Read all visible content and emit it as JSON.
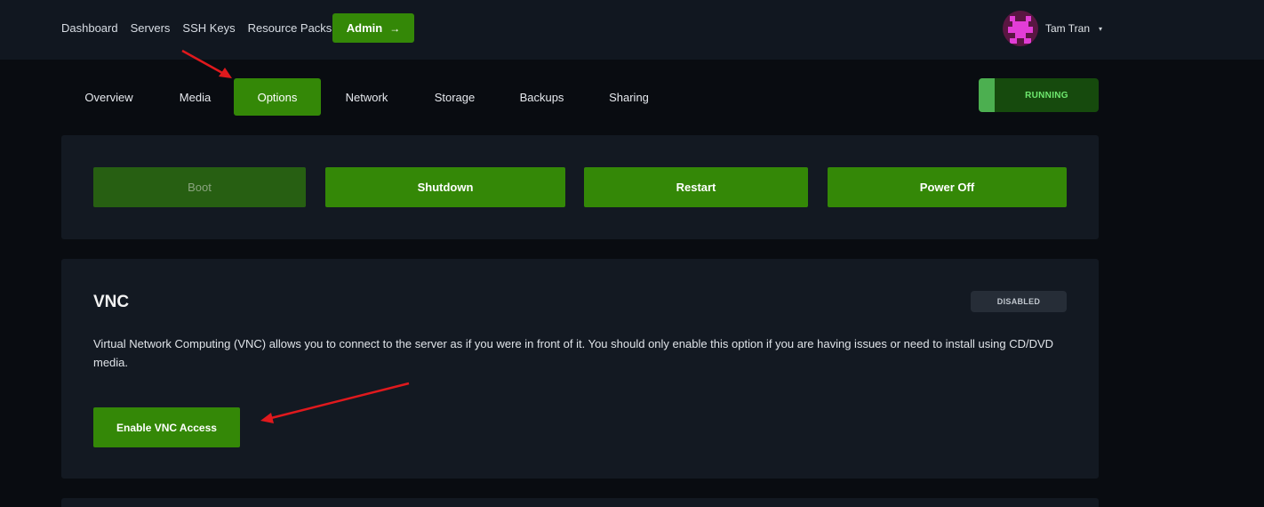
{
  "topnav": {
    "links": [
      "Dashboard",
      "Servers",
      "SSH Keys",
      "Resource Packs"
    ],
    "admin_label": "Admin",
    "admin_arrow": "→"
  },
  "user": {
    "name": "Tam Tran",
    "caret": "▾"
  },
  "tabs": {
    "items": [
      "Overview",
      "Media",
      "Options",
      "Network",
      "Storage",
      "Backups",
      "Sharing"
    ],
    "active": "Options"
  },
  "status": {
    "label": "RUNNING",
    "color": "#4caf50"
  },
  "power": {
    "buttons": [
      {
        "label": "Boot",
        "disabled": true
      },
      {
        "label": "Shutdown",
        "disabled": false
      },
      {
        "label": "Restart",
        "disabled": false
      },
      {
        "label": "Power Off",
        "disabled": false
      }
    ]
  },
  "vnc": {
    "title": "VNC",
    "badge": "DISABLED",
    "description": "Virtual Network Computing (VNC) allows you to connect to the server as if you were in front of it. You should only enable this option if you are having issues or need to install using CD/DVD media.",
    "button_label": "Enable VNC Access"
  },
  "colors": {
    "accent": "#348807",
    "background": "#090c11",
    "panel": "#131922",
    "annotation_arrow": "#e0191d"
  }
}
